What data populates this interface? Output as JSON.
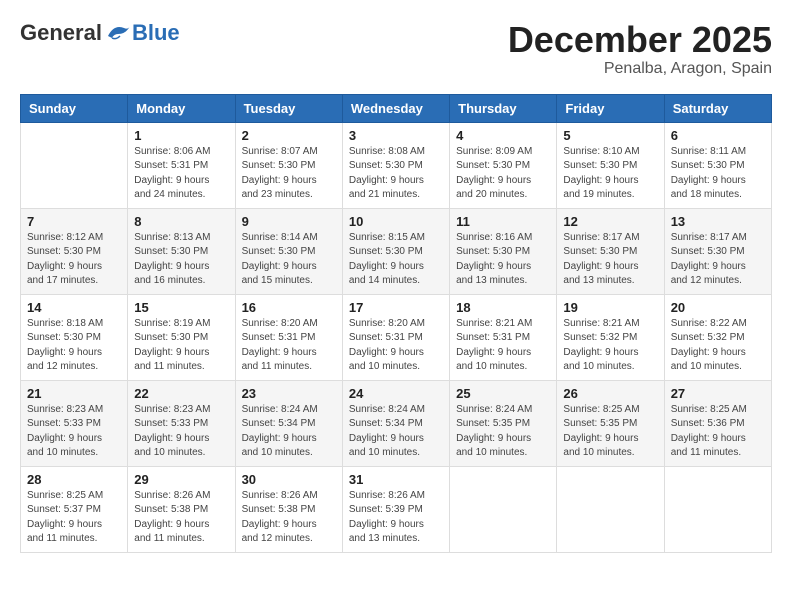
{
  "header": {
    "logo_general": "General",
    "logo_blue": "Blue",
    "month": "December 2025",
    "location": "Penalba, Aragon, Spain"
  },
  "days_of_week": [
    "Sunday",
    "Monday",
    "Tuesday",
    "Wednesday",
    "Thursday",
    "Friday",
    "Saturday"
  ],
  "weeks": [
    [
      {
        "day": "",
        "info": ""
      },
      {
        "day": "1",
        "info": "Sunrise: 8:06 AM\nSunset: 5:31 PM\nDaylight: 9 hours\nand 24 minutes."
      },
      {
        "day": "2",
        "info": "Sunrise: 8:07 AM\nSunset: 5:30 PM\nDaylight: 9 hours\nand 23 minutes."
      },
      {
        "day": "3",
        "info": "Sunrise: 8:08 AM\nSunset: 5:30 PM\nDaylight: 9 hours\nand 21 minutes."
      },
      {
        "day": "4",
        "info": "Sunrise: 8:09 AM\nSunset: 5:30 PM\nDaylight: 9 hours\nand 20 minutes."
      },
      {
        "day": "5",
        "info": "Sunrise: 8:10 AM\nSunset: 5:30 PM\nDaylight: 9 hours\nand 19 minutes."
      },
      {
        "day": "6",
        "info": "Sunrise: 8:11 AM\nSunset: 5:30 PM\nDaylight: 9 hours\nand 18 minutes."
      }
    ],
    [
      {
        "day": "7",
        "info": "Sunrise: 8:12 AM\nSunset: 5:30 PM\nDaylight: 9 hours\nand 17 minutes."
      },
      {
        "day": "8",
        "info": "Sunrise: 8:13 AM\nSunset: 5:30 PM\nDaylight: 9 hours\nand 16 minutes."
      },
      {
        "day": "9",
        "info": "Sunrise: 8:14 AM\nSunset: 5:30 PM\nDaylight: 9 hours\nand 15 minutes."
      },
      {
        "day": "10",
        "info": "Sunrise: 8:15 AM\nSunset: 5:30 PM\nDaylight: 9 hours\nand 14 minutes."
      },
      {
        "day": "11",
        "info": "Sunrise: 8:16 AM\nSunset: 5:30 PM\nDaylight: 9 hours\nand 13 minutes."
      },
      {
        "day": "12",
        "info": "Sunrise: 8:17 AM\nSunset: 5:30 PM\nDaylight: 9 hours\nand 13 minutes."
      },
      {
        "day": "13",
        "info": "Sunrise: 8:17 AM\nSunset: 5:30 PM\nDaylight: 9 hours\nand 12 minutes."
      }
    ],
    [
      {
        "day": "14",
        "info": "Sunrise: 8:18 AM\nSunset: 5:30 PM\nDaylight: 9 hours\nand 12 minutes."
      },
      {
        "day": "15",
        "info": "Sunrise: 8:19 AM\nSunset: 5:30 PM\nDaylight: 9 hours\nand 11 minutes."
      },
      {
        "day": "16",
        "info": "Sunrise: 8:20 AM\nSunset: 5:31 PM\nDaylight: 9 hours\nand 11 minutes."
      },
      {
        "day": "17",
        "info": "Sunrise: 8:20 AM\nSunset: 5:31 PM\nDaylight: 9 hours\nand 10 minutes."
      },
      {
        "day": "18",
        "info": "Sunrise: 8:21 AM\nSunset: 5:31 PM\nDaylight: 9 hours\nand 10 minutes."
      },
      {
        "day": "19",
        "info": "Sunrise: 8:21 AM\nSunset: 5:32 PM\nDaylight: 9 hours\nand 10 minutes."
      },
      {
        "day": "20",
        "info": "Sunrise: 8:22 AM\nSunset: 5:32 PM\nDaylight: 9 hours\nand 10 minutes."
      }
    ],
    [
      {
        "day": "21",
        "info": "Sunrise: 8:23 AM\nSunset: 5:33 PM\nDaylight: 9 hours\nand 10 minutes."
      },
      {
        "day": "22",
        "info": "Sunrise: 8:23 AM\nSunset: 5:33 PM\nDaylight: 9 hours\nand 10 minutes."
      },
      {
        "day": "23",
        "info": "Sunrise: 8:24 AM\nSunset: 5:34 PM\nDaylight: 9 hours\nand 10 minutes."
      },
      {
        "day": "24",
        "info": "Sunrise: 8:24 AM\nSunset: 5:34 PM\nDaylight: 9 hours\nand 10 minutes."
      },
      {
        "day": "25",
        "info": "Sunrise: 8:24 AM\nSunset: 5:35 PM\nDaylight: 9 hours\nand 10 minutes."
      },
      {
        "day": "26",
        "info": "Sunrise: 8:25 AM\nSunset: 5:35 PM\nDaylight: 9 hours\nand 10 minutes."
      },
      {
        "day": "27",
        "info": "Sunrise: 8:25 AM\nSunset: 5:36 PM\nDaylight: 9 hours\nand 11 minutes."
      }
    ],
    [
      {
        "day": "28",
        "info": "Sunrise: 8:25 AM\nSunset: 5:37 PM\nDaylight: 9 hours\nand 11 minutes."
      },
      {
        "day": "29",
        "info": "Sunrise: 8:26 AM\nSunset: 5:38 PM\nDaylight: 9 hours\nand 11 minutes."
      },
      {
        "day": "30",
        "info": "Sunrise: 8:26 AM\nSunset: 5:38 PM\nDaylight: 9 hours\nand 12 minutes."
      },
      {
        "day": "31",
        "info": "Sunrise: 8:26 AM\nSunset: 5:39 PM\nDaylight: 9 hours\nand 13 minutes."
      },
      {
        "day": "",
        "info": ""
      },
      {
        "day": "",
        "info": ""
      },
      {
        "day": "",
        "info": ""
      }
    ]
  ]
}
